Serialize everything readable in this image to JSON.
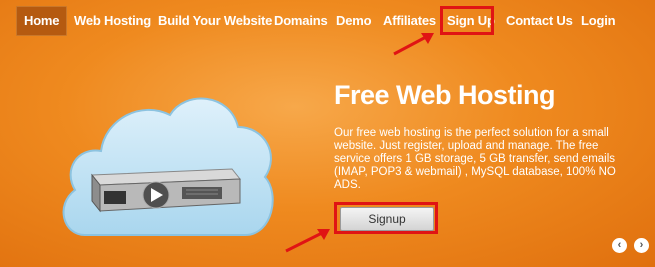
{
  "nav": {
    "items": [
      {
        "label": "Home",
        "active": true
      },
      {
        "label": "Web Hosting"
      },
      {
        "label": "Build Your Website"
      },
      {
        "label": "Domains"
      },
      {
        "label": "Demo"
      },
      {
        "label": "Affiliates"
      },
      {
        "label": "Sign Up"
      },
      {
        "label": "Contact Us"
      },
      {
        "label": "Login"
      }
    ]
  },
  "hero": {
    "title": "Free Web Hosting",
    "description": "Our free web hosting is the perfect solution for a small website. Just register, upload and manage. The free service offers 1 GB storage, 5 GB transfer, send emails (IMAP, POP3 & webmail) , MySQL database, 100% NO ADS.",
    "signup_label": "Signup"
  },
  "slider": {
    "prev_icon": "chevron-left-icon",
    "next_icon": "chevron-right-icon"
  },
  "colors": {
    "background": "#ef8a1f",
    "nav_active": "#b55a10",
    "highlight": "#e01414"
  }
}
